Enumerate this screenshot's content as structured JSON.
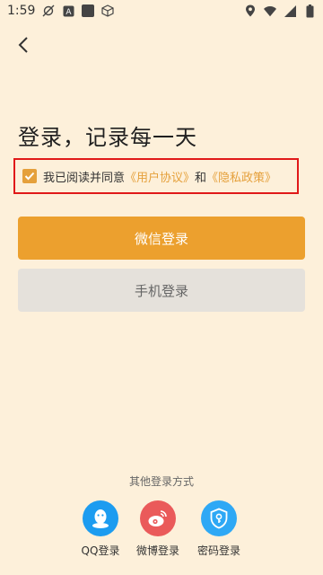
{
  "status_bar": {
    "time": "1:59",
    "icons": [
      "sync-off-icon",
      "a-box-icon",
      "square-icon",
      "cube-icon",
      "location-icon",
      "wifi-icon",
      "signal-icon",
      "battery-icon"
    ]
  },
  "header": {
    "back_icon": "chevron-left-icon"
  },
  "headline": "登录，记录每一天",
  "agreement": {
    "checked": true,
    "prefix": "我已阅读并同意",
    "user_agreement": "《用户协议》",
    "conjunction": "和",
    "privacy_policy": "《隐私政策》"
  },
  "buttons": {
    "wechat_login": "微信登录",
    "phone_login": "手机登录"
  },
  "other_login": {
    "title": "其他登录方式",
    "items": [
      {
        "label": "QQ登录",
        "icon": "qq-icon",
        "color": "#1c9cf0"
      },
      {
        "label": "微博登录",
        "icon": "weibo-icon",
        "color": "#ea5a5a"
      },
      {
        "label": "密码登录",
        "icon": "shield-key-icon",
        "color": "#2ea8f5"
      }
    ]
  },
  "colors": {
    "background": "#fdf0da",
    "accent": "#eca02e",
    "link": "#e5a03b",
    "highlight_border": "#e01919",
    "secondary_button": "#e5e1db"
  }
}
